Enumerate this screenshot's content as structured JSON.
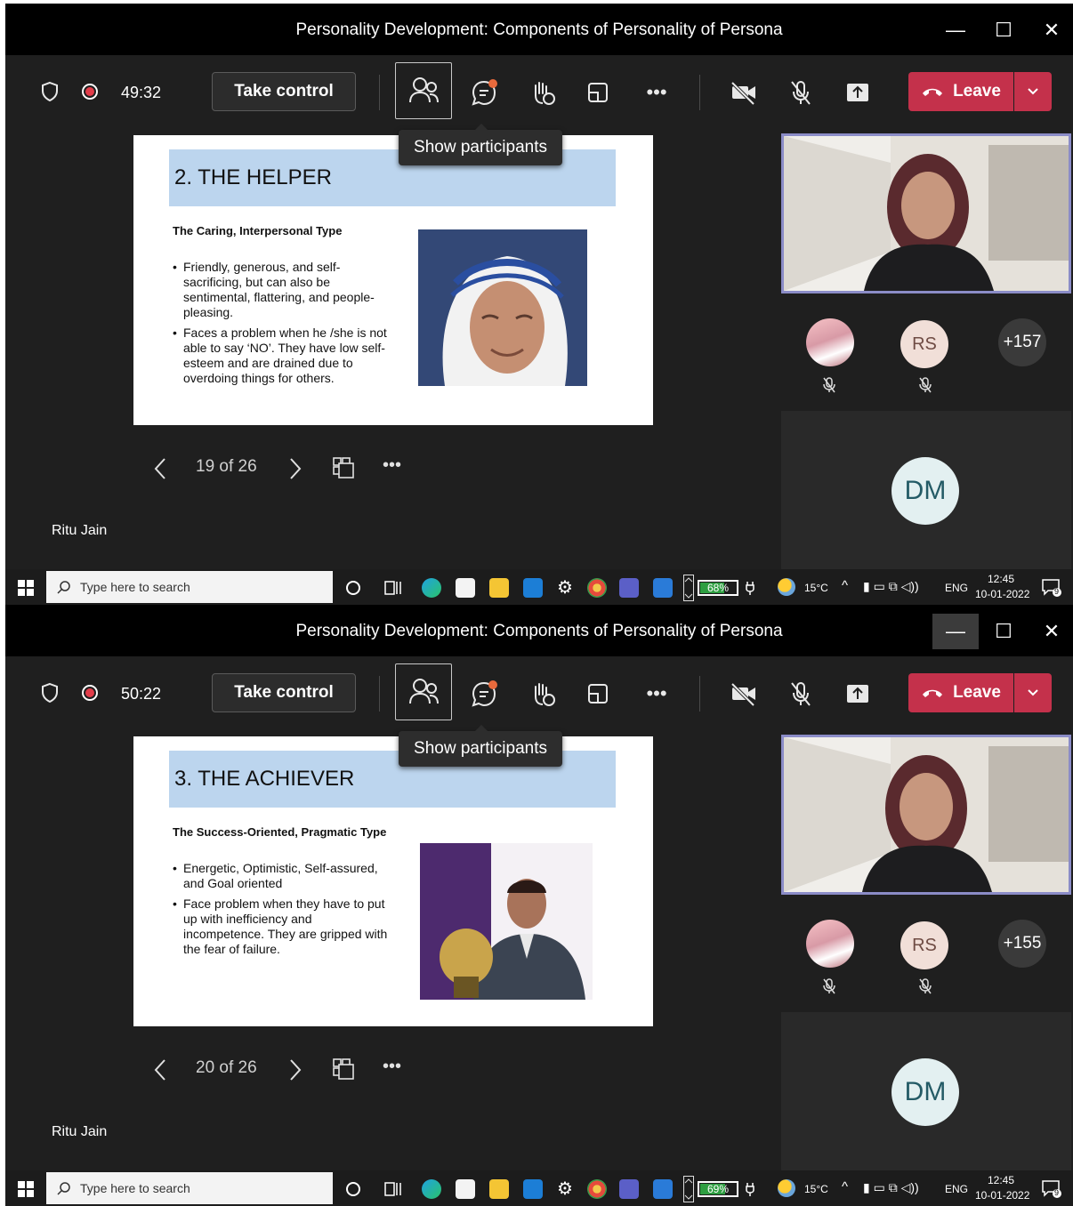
{
  "shots": [
    {
      "window_title": "Personality Development: Components of Personality of Persona",
      "timer": "49:32",
      "take_control_label": "Take control",
      "leave_label": "Leave",
      "tooltip": "Show participants",
      "slide": {
        "title": "2. THE HELPER",
        "subtitle": "The Caring, Interpersonal Type",
        "bullets": [
          "Friendly, generous, and self-sacrificing, but can also be sentimental, flattering, and people-pleasing.",
          "Faces a problem when he /she is not able to say ‘NO’. They have low self-esteem and are drained due to overdoing things for others."
        ]
      },
      "slide_counter": "19 of 26",
      "presenter_name": "Ritu Jain",
      "participants": {
        "rs_initials": "RS",
        "more_count": "+157",
        "dm_initials": "DM"
      },
      "taskbar": {
        "search_placeholder": "Type here to search",
        "battery": "68%",
        "battery_level": 0.68,
        "temperature": "15°C",
        "lang": "ENG",
        "time": "12:45",
        "date": "10-01-2022",
        "notif_count": "9"
      }
    },
    {
      "window_title": "Personality Development: Components of Personality of Persona",
      "timer": "50:22",
      "take_control_label": "Take control",
      "leave_label": "Leave",
      "tooltip": "Show participants",
      "slide": {
        "title": "3. THE ACHIEVER",
        "subtitle": "The Success-Oriented, Pragmatic Type",
        "bullets": [
          "Energetic, Optimistic, Self-assured, and Goal oriented",
          "Face problem when they have to put up with inefficiency and incompetence. They are gripped with the fear of failure."
        ]
      },
      "slide_counter": "20 of 26",
      "presenter_name": "Ritu Jain",
      "participants": {
        "rs_initials": "RS",
        "more_count": "+155",
        "dm_initials": "DM"
      },
      "taskbar": {
        "search_placeholder": "Type here to search",
        "battery": "69%",
        "battery_level": 0.69,
        "temperature": "15°C",
        "lang": "ENG",
        "time": "12:45",
        "date": "10-01-2022",
        "notif_count": "9"
      }
    }
  ],
  "colors": {
    "leave": "#c4314b",
    "tile_border": "#8b8cc7",
    "slide_title_band": "#bcd5ee",
    "record": "#e23d4a"
  }
}
